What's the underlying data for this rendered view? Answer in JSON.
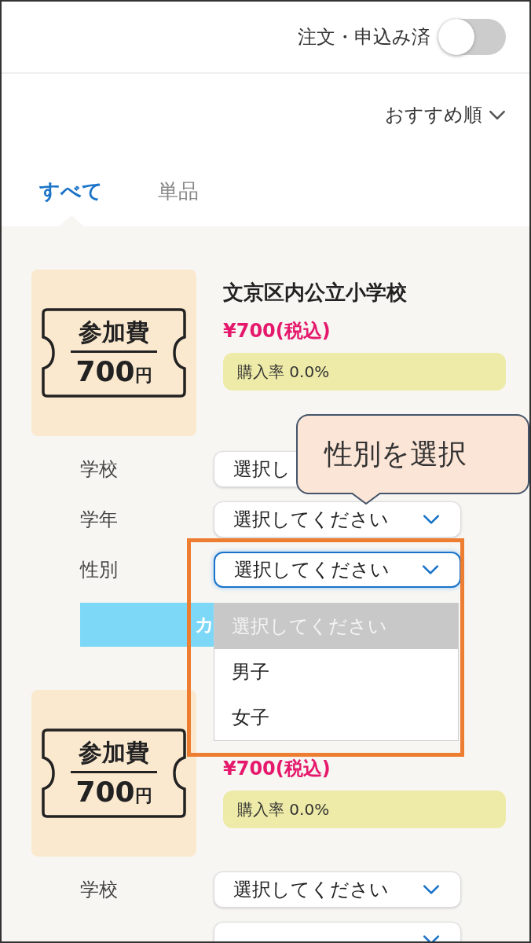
{
  "header": {
    "toggle": {
      "label": "注文・申込み済",
      "on": false
    }
  },
  "sort": {
    "label": "おすすめ順"
  },
  "tabs": [
    {
      "label": "すべて",
      "selected": true
    },
    {
      "label": "単品",
      "selected": false
    }
  ],
  "products": [
    {
      "ticket": {
        "title": "参加費",
        "amount": "700",
        "unit": "円"
      },
      "name": "文京区内公立小学校",
      "price": "¥700(税込)",
      "rate": "購入率 0.0%",
      "fields": [
        {
          "label": "学校",
          "value": "選択し",
          "focused": false
        },
        {
          "label": "学年",
          "value": "選択してください",
          "focused": false
        },
        {
          "label": "性別",
          "value": "選択してください",
          "focused": true
        }
      ],
      "button": "カ"
    },
    {
      "ticket": {
        "title": "参加費",
        "amount": "700",
        "unit": "円"
      },
      "price": "¥700(税込)",
      "rate": "購入率 0.0%",
      "fields": [
        {
          "label": "学校",
          "value": "選択してください",
          "focused": false
        },
        {
          "focused": false
        }
      ]
    }
  ],
  "dropdown": {
    "options": [
      {
        "label": "選択してください",
        "selected": true
      },
      {
        "label": "男子",
        "selected": false
      },
      {
        "label": "女子",
        "selected": false
      }
    ]
  },
  "callout": {
    "text": "性別を選択"
  }
}
